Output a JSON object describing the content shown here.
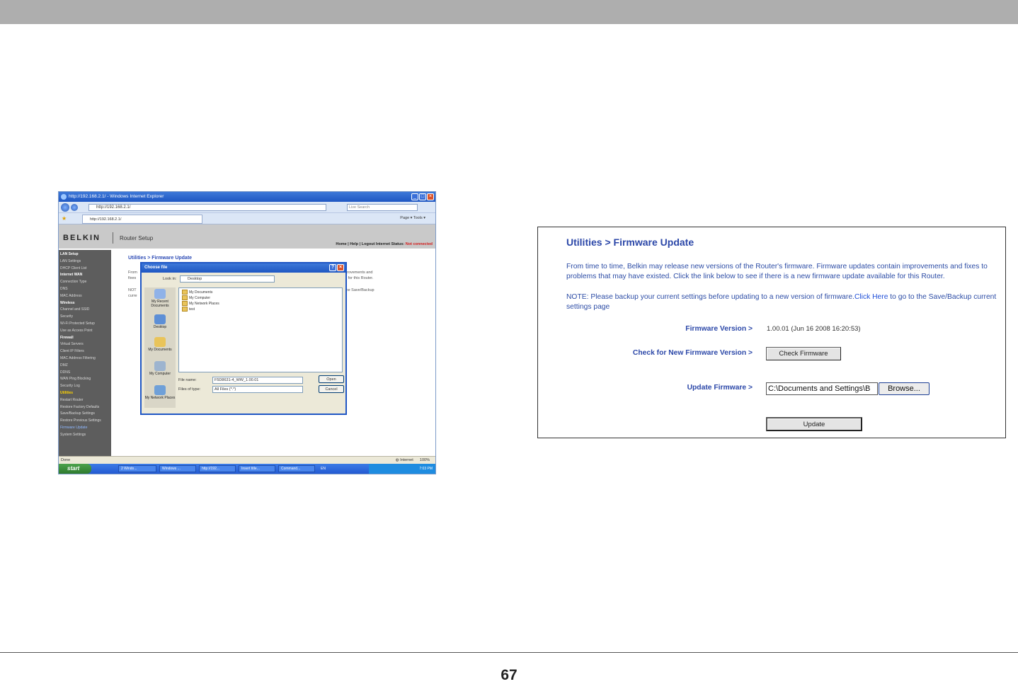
{
  "page_number": "67",
  "screenshot": {
    "ie": {
      "title": "http://192.168.2.1/ - Windows Internet Explorer",
      "address": "http://192.168.2.1/",
      "search_placeholder": "Live Search",
      "tab_label": "http://192.168.2.1/",
      "toolbar_text": "Page ▾   Tools ▾",
      "status_left": "Done",
      "status_zone": "Internet",
      "zoom": "100%"
    },
    "router": {
      "logo": "BELKIN",
      "subtitle": "Router Setup",
      "top_links": "Home | Help | Logout   Internet Status:",
      "internet_status": "Not connected",
      "sidebar": [
        {
          "label": "LAN Setup",
          "type": "sec"
        },
        {
          "label": "LAN Settings",
          "type": "item"
        },
        {
          "label": "DHCP Client List",
          "type": "item"
        },
        {
          "label": "Internet WAN",
          "type": "sec"
        },
        {
          "label": "Connection Type",
          "type": "item"
        },
        {
          "label": "DNS",
          "type": "item"
        },
        {
          "label": "MAC Address",
          "type": "item"
        },
        {
          "label": "Wireless",
          "type": "sec"
        },
        {
          "label": "Channel and SSID",
          "type": "item"
        },
        {
          "label": "Security",
          "type": "item"
        },
        {
          "label": "Wi-Fi Protected Setup",
          "type": "item"
        },
        {
          "label": "Use as Access Point",
          "type": "item"
        },
        {
          "label": "Firewall",
          "type": "sec"
        },
        {
          "label": "Virtual Servers",
          "type": "item"
        },
        {
          "label": "Client IP Filters",
          "type": "item"
        },
        {
          "label": "MAC Address Filtering",
          "type": "item"
        },
        {
          "label": "DMZ",
          "type": "item"
        },
        {
          "label": "DDNS",
          "type": "item"
        },
        {
          "label": "WAN Ping Blocking",
          "type": "item"
        },
        {
          "label": "Security Log",
          "type": "item"
        },
        {
          "label": "Utilities",
          "type": "hot"
        },
        {
          "label": "Restart Router",
          "type": "item"
        },
        {
          "label": "Restore Factory Defaults",
          "type": "item"
        },
        {
          "label": "Save/Backup Settings",
          "type": "item"
        },
        {
          "label": "Restore Previous Settings",
          "type": "item"
        },
        {
          "label": "Firmware Update",
          "type": "cur"
        },
        {
          "label": "System Settings",
          "type": "item"
        }
      ],
      "main_title": "Utilities > Firmware Update",
      "frag_1": "From",
      "frag_2": "fixes",
      "frag_3": "NOT",
      "frag_4": "curre",
      "frag_5": "provements and",
      "frag_6": "e for this Router.",
      "frag_7": "the Save/Backup"
    },
    "dialog": {
      "title": "Choose file",
      "look_in_label": "Look in:",
      "look_in_value": "Desktop",
      "places": [
        "My Recent Documents",
        "Desktop",
        "My Documents",
        "My Computer",
        "My Network Places"
      ],
      "files": [
        "My Documents",
        "My Computer",
        "My Network Places",
        "test"
      ],
      "file_name_label": "File name:",
      "file_name_value": "F5D8631-4_WW_1.00.01",
      "file_type_label": "Files of type:",
      "file_type_value": "All Files (*.*)",
      "open_label": "Open",
      "cancel_label": "Cancel"
    },
    "taskbar": {
      "start": "start",
      "items": [
        "2 Windo...",
        "Windows ...",
        "http://192...",
        "Insert title...",
        "Command..."
      ],
      "lang": "EN",
      "clock": "7:03 PM"
    }
  },
  "firmware_panel": {
    "title": "Utilities > Firmware Update",
    "para1": "From time to time, Belkin may release new versions of the Router's firmware. Firmware updates contain improvements and fixes to problems that may have existed. Click the link below to see if there is a new firmware update available for this Router.",
    "note_before": "NOTE: Please backup your current settings before updating to a new version of firmware.",
    "note_link": "Click Here",
    "note_after": " to go to the Save/Backup current settings page",
    "firmware_version_label": "Firmware Version >",
    "firmware_version_value": "1.00.01 (Jun 16 2008 16:20:53)",
    "check_label": "Check for New Firmware Version >",
    "check_button": "Check Firmware",
    "update_label": "Update Firmware >",
    "file_value": "C:\\Documents and Settings\\B",
    "browse_button": "Browse...",
    "update_button": "Update"
  }
}
